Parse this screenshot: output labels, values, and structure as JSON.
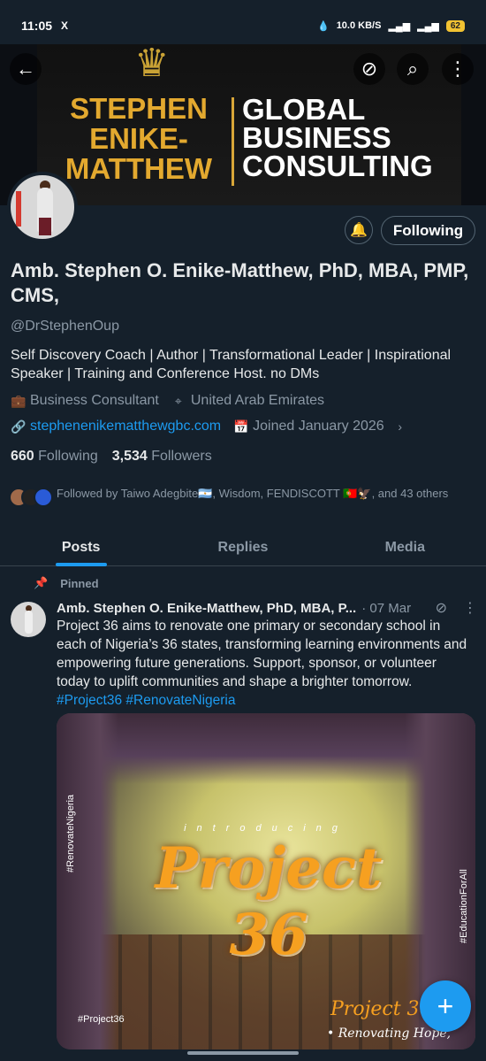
{
  "status_bar": {
    "time": "11:05",
    "notif": "X",
    "net_speed": "10.0 KB/S",
    "battery": "62"
  },
  "banner": {
    "left_text": "STEPHEN ENIKE- MATTHEW",
    "right_text": "GLOBAL BUSINESS CONSULTING"
  },
  "profile": {
    "following_btn": "Following",
    "name": "Amb. Stephen O. Enike-Matthew, PhD, MBA, PMP, CMS,",
    "handle": "@DrStephenOup",
    "bio": "Self Discovery Coach | Author | Transformational Leader | Inspirational Speaker | Training and Conference Host. no DMs",
    "category": "Business Consultant",
    "location": "United Arab Emirates",
    "website": "stephenenikematthewgbc.com",
    "joined": "Joined January 2026",
    "following_count": "660",
    "following_label": "Following",
    "followers_count": "3,534",
    "followers_label": "Followers",
    "followed_by": "Followed by Taiwo Adegbite🇦🇷, Wisdom, FENDISCOTT 🇵🇹🦅, and 43 others"
  },
  "tabs": [
    {
      "label": "Posts"
    },
    {
      "label": "Replies"
    },
    {
      "label": "Media"
    }
  ],
  "pinned_post": {
    "pinned_label": "Pinned",
    "author": "Amb. Stephen O. Enike-Matthew, PhD, MBA, P...",
    "date": "· 07 Mar",
    "text": "Project 36 aims to renovate one primary or secondary school in each of Nigeria’s 36 states, transforming learning environments and empowering future generations. Support, sponsor, or volunteer today to uplift communities and shape a brighter tomorrow.",
    "hashtags": "#Project36 #RenovateNigeria",
    "media": {
      "introducing": "introducing",
      "title": "Project 36",
      "left_side": "#RenovateNigeria",
      "right_side": "#EducationForAll",
      "bottom_tag": "#Project36",
      "small_title": "Project 36",
      "tagline": "• Renovating Hope,"
    }
  },
  "colors": {
    "background": "#15202b",
    "accent": "#1d9bf0",
    "muted": "#8b98a5",
    "banner_gold": "#e3a92f"
  }
}
